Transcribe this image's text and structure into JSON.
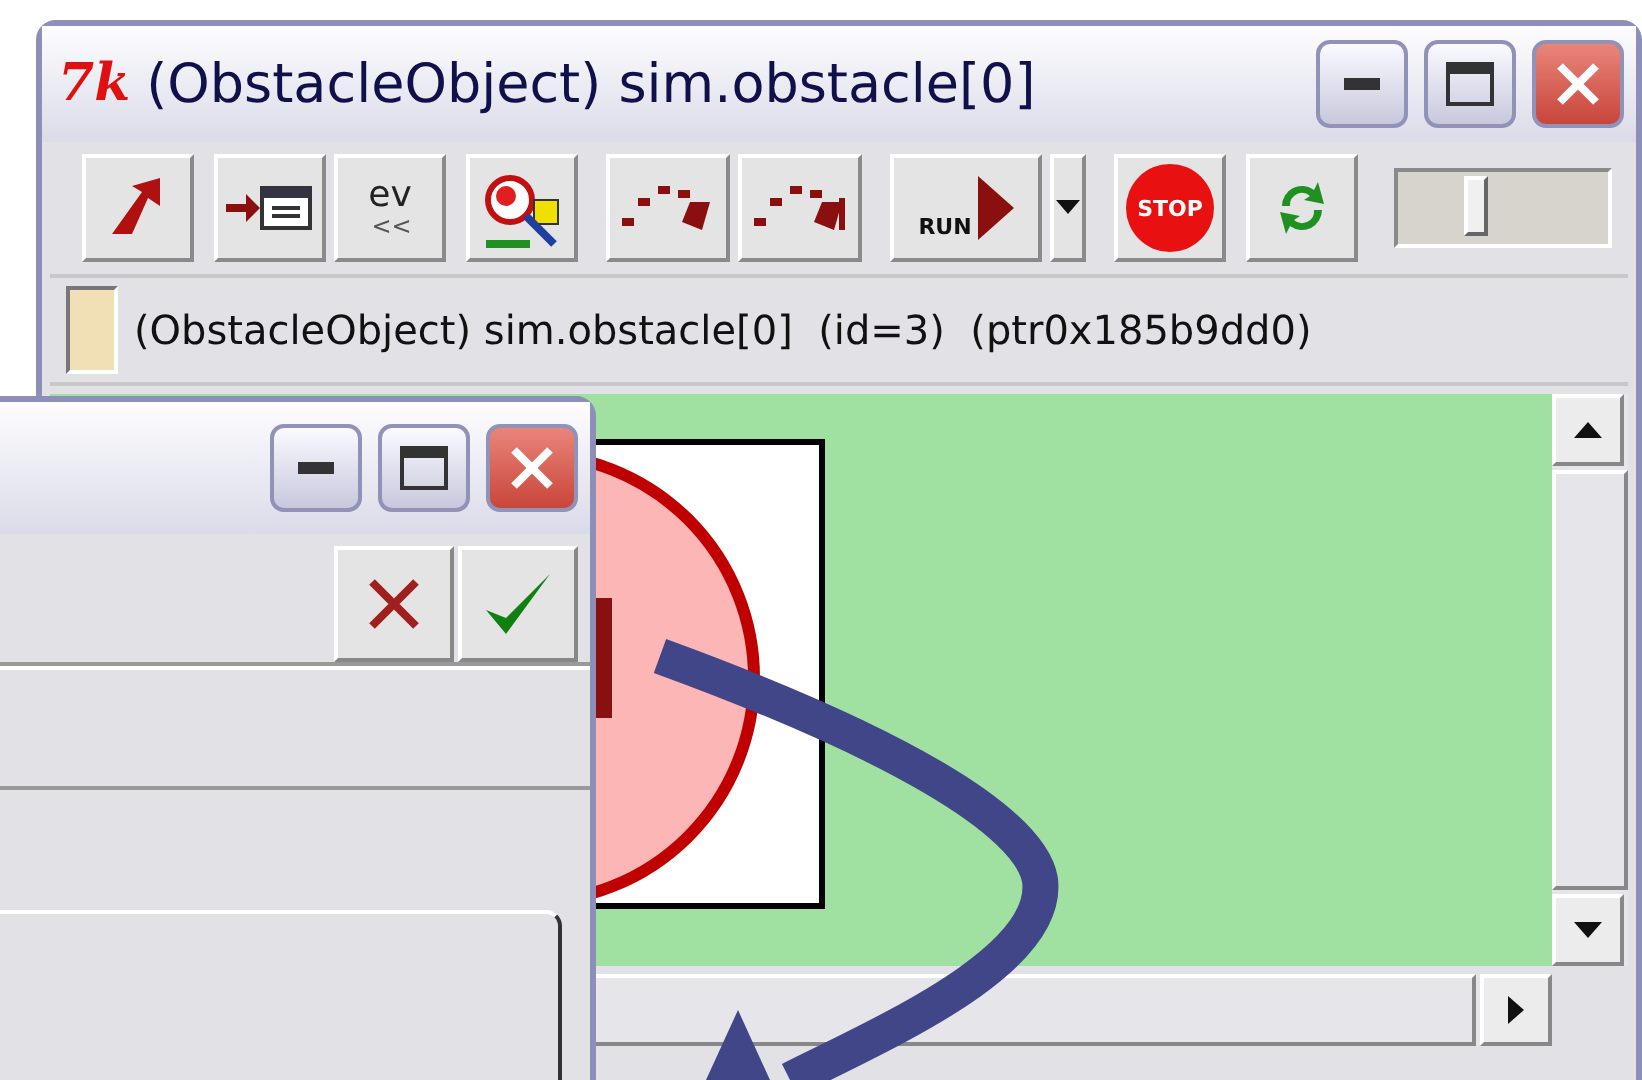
{
  "back_window": {
    "title": "(ObstacleObject) sim.obstacle[0]",
    "icon": "7k",
    "toolbar": [
      {
        "kind": "up"
      },
      {
        "kind": "into"
      },
      {
        "kind": "ev",
        "label": "ev",
        "sublabel": "<<"
      },
      {
        "kind": "find"
      },
      {
        "kind": "step"
      },
      {
        "kind": "step2"
      },
      {
        "kind": "run",
        "label": "RUN"
      },
      {
        "kind": "drop"
      },
      {
        "kind": "stop",
        "label": "STOP"
      },
      {
        "kind": "refresh"
      }
    ],
    "speed": {
      "level": 0.37
    },
    "info": "(ObstacleObject) sim.obstacle[0]  (id=3)  (ptr0x185b9dd0)"
  },
  "front_window": {
    "buttons": [
      {
        "kind": "cancel"
      },
      {
        "kind": "ok"
      }
    ]
  }
}
